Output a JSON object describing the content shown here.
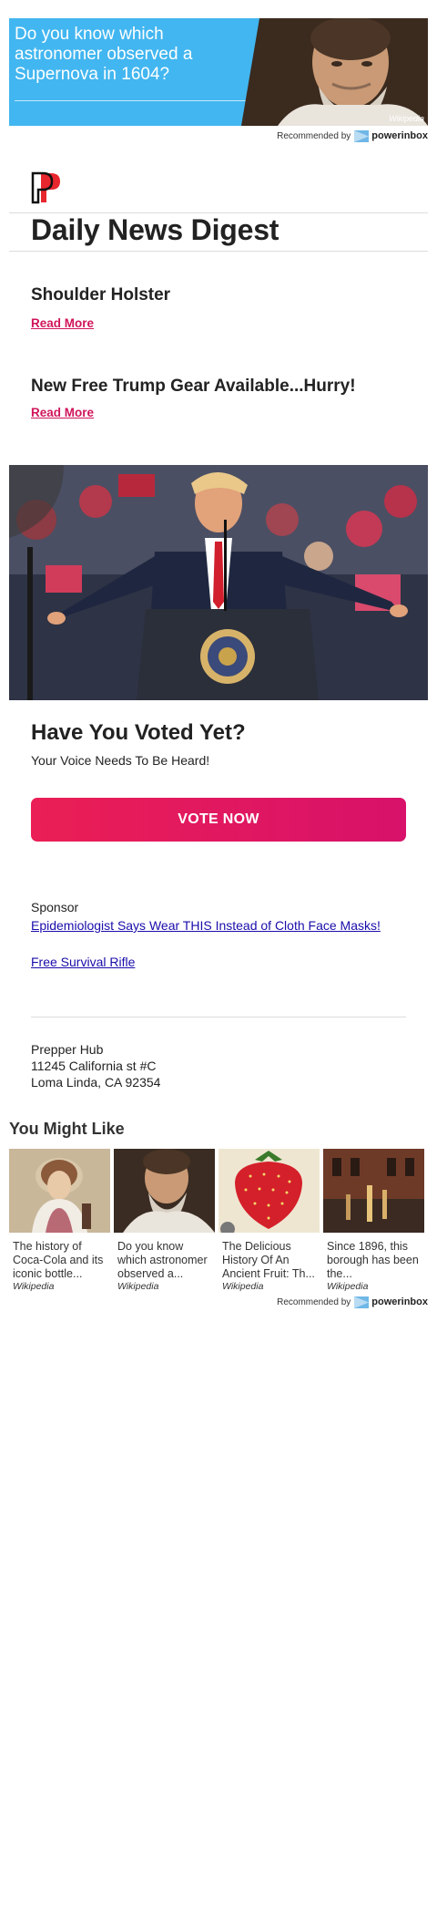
{
  "top_ad": {
    "headline": "Do you know which astronomer observed a Supernova in 1604?",
    "source": "Wikipedia"
  },
  "recommended": {
    "label": "Recommended by",
    "brand": "powerinbox"
  },
  "newsletter": {
    "title": "Daily News Digest",
    "articles": [
      {
        "title": "Shoulder Holster",
        "link": "Read More"
      },
      {
        "title": "New Free Trump Gear Available...Hurry!",
        "link": "Read More"
      }
    ],
    "vote": {
      "title": "Have You Voted Yet?",
      "subtitle": "Your Voice Needs To Be Heard!",
      "button": "VOTE NOW"
    },
    "sponsor": {
      "label": "Sponsor",
      "links": [
        "Epidemiologist Says Wear THIS Instead of Cloth Face Masks!",
        "Free Survival Rifle"
      ]
    },
    "address": [
      "Prepper Hub",
      "11245 California st #C",
      "Loma Linda, CA 92354"
    ]
  },
  "you_might_like": {
    "title": "You Might Like",
    "cards": [
      {
        "caption": "The history of Coca-Cola and its iconic bottle...",
        "source": "Wikipedia"
      },
      {
        "caption": "Do you know which astronomer observed a...",
        "source": "Wikipedia"
      },
      {
        "caption": "The Delicious History Of An Ancient Fruit: Th...",
        "source": "Wikipedia"
      },
      {
        "caption": "Since 1896, this borough has been the...",
        "source": "Wikipedia"
      }
    ]
  },
  "colors": {
    "ad_blue": "#42b6f0",
    "accent_pink": "#d0155a",
    "link_blue": "#1a0dab",
    "logo_red": "#e8262d"
  }
}
